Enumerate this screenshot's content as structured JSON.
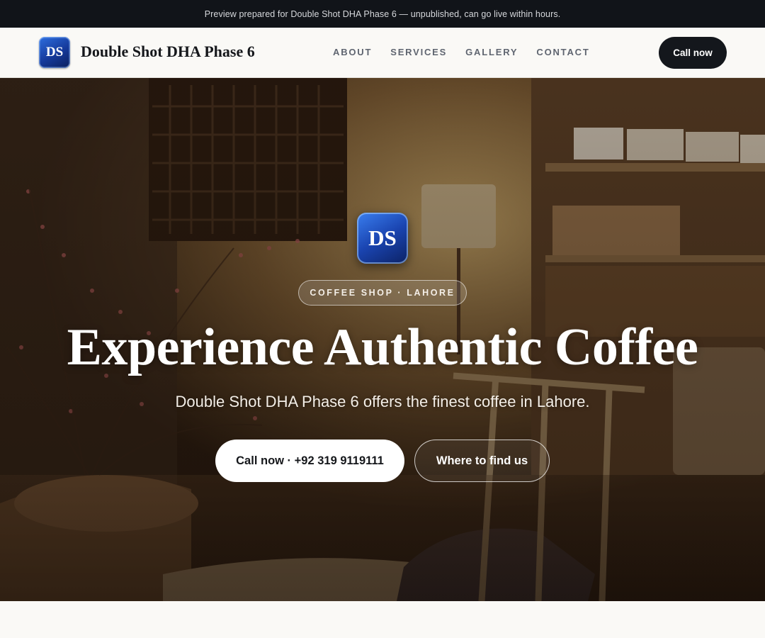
{
  "announcement": {
    "text": "Preview prepared for Double Shot DHA Phase 6 — unpublished, can go live within hours."
  },
  "header": {
    "logo_initials": "DS",
    "brand_name": "Double Shot DHA Phase 6",
    "nav": [
      {
        "label": "ABOUT"
      },
      {
        "label": "SERVICES"
      },
      {
        "label": "GALLERY"
      },
      {
        "label": "CONTACT"
      }
    ],
    "cta_label": "Call now"
  },
  "hero": {
    "badge_initials": "DS",
    "eyebrow": "COFFEE SHOP · LAHORE",
    "title": "Experience Authentic Coffee",
    "subtitle": "Double Shot DHA Phase 6 offers the finest coffee in Lahore.",
    "primary_button": "Call now · +92 319 9119111",
    "secondary_button": "Where to find us"
  },
  "colors": {
    "topbar_bg": "#111419",
    "page_bg": "#faf9f6",
    "dark_button": "#14171c",
    "brand_blue": "#1a44b0"
  },
  "icons": {
    "logo": "ds-logo-badge",
    "hero_logo": "ds-logo-badge-large"
  }
}
